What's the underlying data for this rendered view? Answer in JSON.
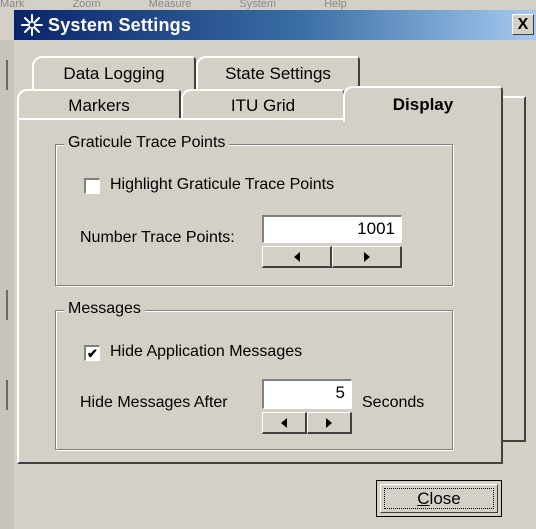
{
  "background": {
    "menu_fragments": [
      "Mark",
      "Zoom",
      "Measure",
      "System",
      "Help"
    ]
  },
  "window": {
    "title": "System Settings",
    "close_glyph": "X"
  },
  "tabs": {
    "back_row": [
      {
        "label": "Data Logging"
      },
      {
        "label": "State Settings"
      }
    ],
    "front_row": [
      {
        "label": "Markers"
      },
      {
        "label": "ITU Grid"
      },
      {
        "label": "Display",
        "active": true
      }
    ]
  },
  "graticule": {
    "title": "Graticule Trace Points",
    "highlight_label": "Highlight Graticule Trace Points",
    "highlight_checked": false,
    "number_label": "Number Trace Points:",
    "number_value": "1001"
  },
  "messages": {
    "title": "Messages",
    "hide_label": "Hide Application Messages",
    "hide_checked": true,
    "after_label": "Hide Messages After",
    "after_value": "5",
    "unit_label": "Seconds",
    "check_mark": "✔"
  },
  "footer": {
    "close_accel": "C",
    "close_rest": "lose"
  },
  "colors": {
    "dialog_face": "#d4d0c8",
    "title_start": "#0a246a",
    "title_end": "#a6caf0"
  }
}
